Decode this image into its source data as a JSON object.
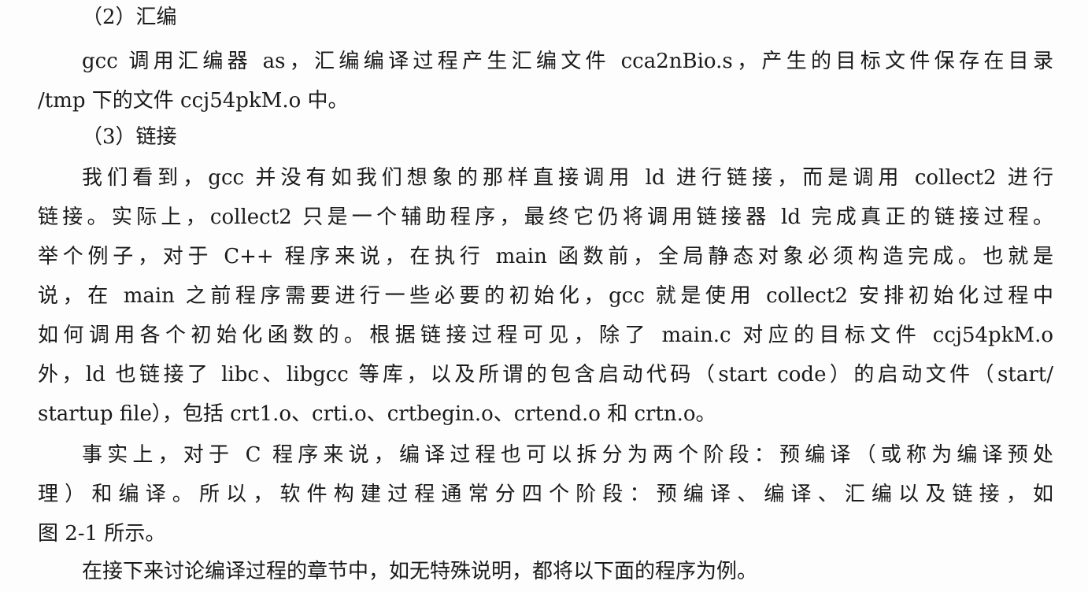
{
  "document": {
    "lines": [
      {
        "text": "（2）汇编"
      },
      {
        "text": "gcc 调用汇编器 as，汇编编译过程产生汇编文件 cca2nBio.s，产生的目标文件保存在目录"
      },
      {
        "text": "/tmp 下的文件 ccj54pkM.o 中。"
      },
      {
        "text": "（3）链接"
      },
      {
        "text": "我们看到，gcc 并没有如我们想象的那样直接调用 ld 进行链接，而是调用 collect2 进行"
      },
      {
        "text": "链接。实际上，collect2 只是一个辅助程序，最终它仍将调用链接器 ld 完成真正的链接过程。"
      },
      {
        "text": "举个例子，对于 C++ 程序来说，在执行 main 函数前，全局静态对象必须构造完成。也就是"
      },
      {
        "text": "说，在 main 之前程序需要进行一些必要的初始化，gcc 就是使用 collect2 安排初始化过程中"
      },
      {
        "text": "如何调用各个初始化函数的。根据链接过程可见，除了 main.c 对应的目标文件 ccj54pkM.o"
      },
      {
        "text": "外，ld 也链接了 libc、libgcc 等库，以及所谓的包含启动代码（start code）的启动文件（start/"
      },
      {
        "text": "startup file），包括 crt1.o、crti.o、crtbegin.o、crtend.o 和 crtn.o。"
      },
      {
        "text": "事实上，对于 C 程序来说，编译过程也可以拆分为两个阶段：预编译（或称为编译预处"
      },
      {
        "text": "理）和编译。所以，软件构建过程通常分四个阶段：预编译、编译、汇编以及链接，如"
      },
      {
        "text": "图 2-1 所示。"
      },
      {
        "text": "在接下来讨论编译过程的章节中，如无特殊说明，都将以下面的程序为例。"
      }
    ]
  }
}
